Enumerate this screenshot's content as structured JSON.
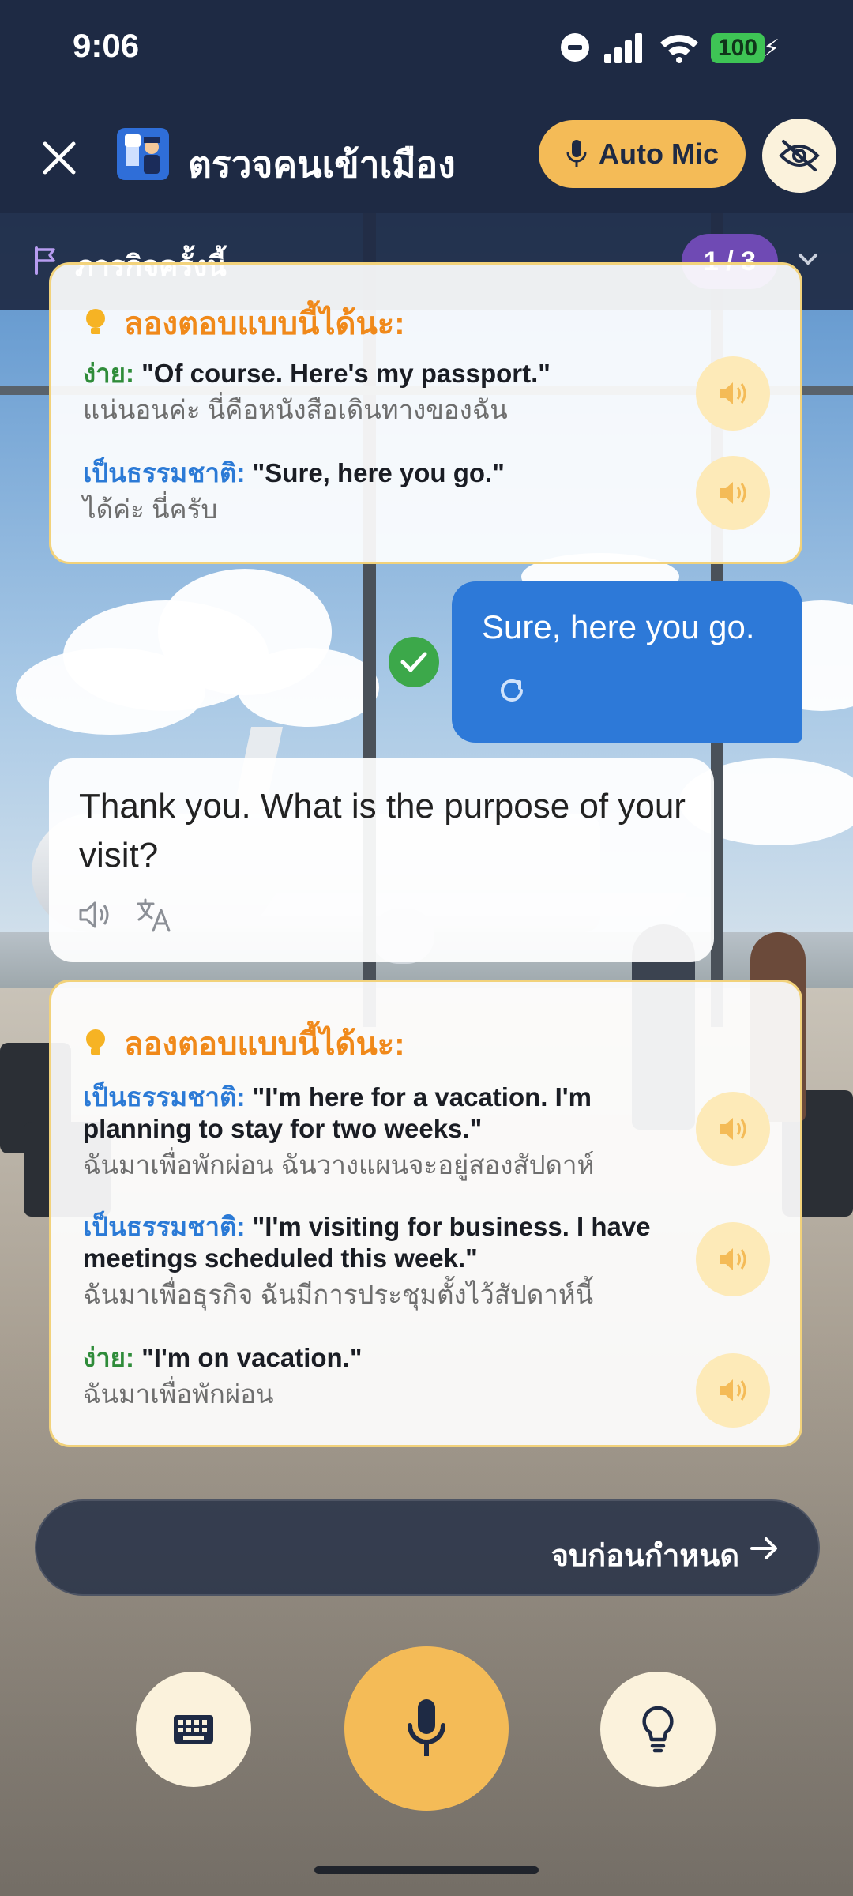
{
  "status_bar": {
    "time": "9:06",
    "battery": "100"
  },
  "header": {
    "title": "ตรวจคนเข้าเมือง",
    "auto_mic_label": "Auto Mic"
  },
  "mission": {
    "label": "ภารกิจครั้งนี้",
    "counter": "1 / 3"
  },
  "suggestions_top": {
    "heading": "ลองตอบแบบนี้ได้นะ:",
    "items": [
      {
        "tag": "ง่าย:",
        "en": "\"Of course. Here's my passport.\"",
        "th": "แน่นอนค่ะ นี่คือหนังสือเดินทางของฉัน"
      },
      {
        "tag": "เป็นธรรมชาติ:",
        "en": "\"Sure, here you go.\"",
        "th": "ได้ค่ะ นี่ครับ"
      }
    ]
  },
  "user_message": {
    "text": "Sure, here you go."
  },
  "bot_message": {
    "text": "Thank you. What is the purpose of your visit?"
  },
  "suggestions_bottom": {
    "heading": "ลองตอบแบบนี้ได้นะ:",
    "items": [
      {
        "tag": "เป็นธรรมชาติ:",
        "en": "\"I'm here for a vacation. I'm planning to stay for two weeks.\"",
        "th": "ฉันมาเพื่อพักผ่อน ฉันวางแผนจะอยู่สองสัปดาห์"
      },
      {
        "tag": "เป็นธรรมชาติ:",
        "en": "\"I'm visiting for business. I have meetings scheduled this week.\"",
        "th": "ฉันมาเพื่อธุรกิจ ฉันมีการประชุมตั้งไว้สัปดาห์นี้"
      },
      {
        "tag": "ง่าย:",
        "en": "\"I'm on vacation.\"",
        "th": "ฉันมาเพื่อพักผ่อน"
      }
    ]
  },
  "end_early": {
    "label": "จบก่อนกำหนด"
  },
  "colors": {
    "accent": "#f4bb57",
    "navy": "#1e2a44",
    "user_bubble": "#2d79d8",
    "suggestion_heading": "#f0891a",
    "counter_bg": "#6f4ab4"
  }
}
